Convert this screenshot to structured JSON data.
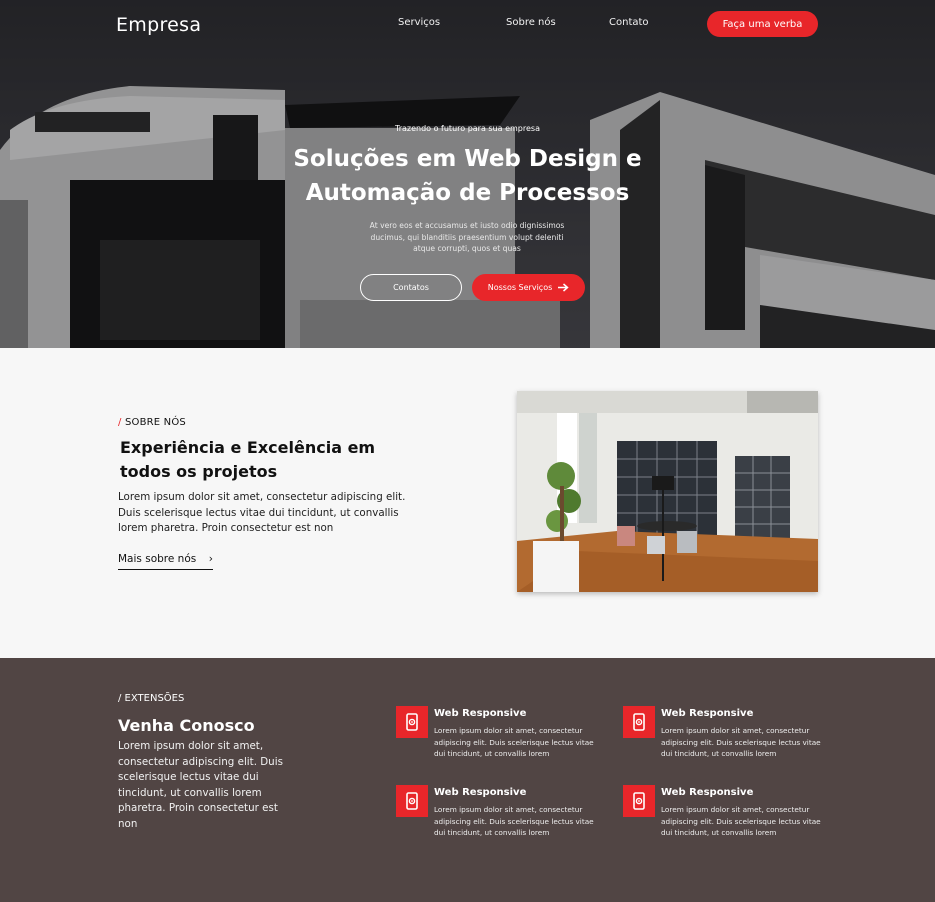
{
  "header": {
    "logo": "Empresa",
    "nav": [
      "Serviços",
      "Sobre nós",
      "Contato"
    ],
    "cta": "Faça uma verba"
  },
  "hero": {
    "eyebrow": "Trazendo o futuro para sua empresa",
    "title_line1": "Soluções em Web Design e",
    "title_line2": "Automação de Processos",
    "description": "At vero eos et accusamus et iusto odio dignissimos ducimus, qui blanditiis praesentium volupt deleniti atque corrupti, quos et quas",
    "btn_contacts": "Contatos",
    "btn_services": "Nossos Serviços"
  },
  "about": {
    "tag_slash": "/",
    "tag": " SOBRE NÓS",
    "title": "Experiência e Excelência em todos os projetos",
    "text": "Lorem ipsum dolor sit amet, consectetur adipiscing elit. Duis scelerisque lectus vitae dui tincidunt, ut convallis lorem pharetra. Proin consectetur est non",
    "link": "Mais sobre nós",
    "link_chevron": "›"
  },
  "extensions": {
    "tag": "/ EXTENSÕES",
    "title": "Venha Conosco",
    "text": "Lorem ipsum dolor sit amet, consectetur adipiscing elit. Duis scelerisque lectus vitae dui tincidunt, ut convallis lorem pharetra. Proin consectetur est non",
    "cards": [
      {
        "title": "Web Responsive",
        "text": "Lorem ipsum dolor sit amet, consectetur adipiscing elit. Duis scelerisque lectus vitae dui tincidunt, ut convallis lorem"
      },
      {
        "title": "Web Responsive",
        "text": "Lorem ipsum dolor sit amet, consectetur adipiscing elit. Duis scelerisque lectus vitae dui tincidunt, ut convallis lorem"
      },
      {
        "title": "Web Responsive",
        "text": "Lorem ipsum dolor sit amet, consectetur adipiscing elit. Duis scelerisque lectus vitae dui tincidunt, ut convallis lorem"
      },
      {
        "title": "Web Responsive",
        "text": "Lorem ipsum dolor sit amet, consectetur adipiscing elit. Duis scelerisque lectus vitae dui tincidunt, ut convallis lorem"
      }
    ]
  },
  "icons": {
    "arrow": "arrow-right-icon",
    "chevron": "chevron-right-icon",
    "card": "mobile-gear-icon"
  },
  "colors": {
    "accent": "#e8262a",
    "dark_section": "#514544",
    "light_section": "#f7f7f7"
  }
}
